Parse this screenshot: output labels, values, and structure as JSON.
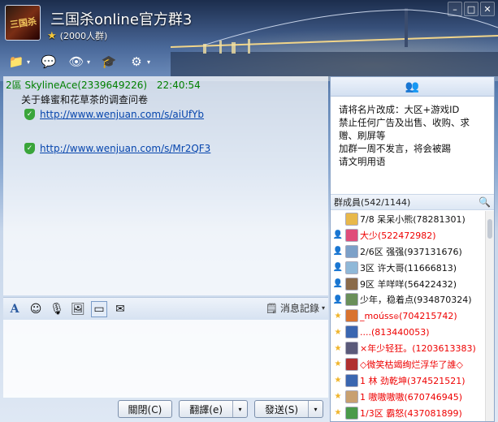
{
  "window": {
    "title": "三国杀online官方群3",
    "member_capacity": "(2000人群)",
    "logo_text": "三国杀",
    "controls": [
      "–",
      "□",
      "✕"
    ]
  },
  "toolbar": {
    "items": [
      {
        "name": "folder-tool",
        "icon": "📁"
      },
      {
        "name": "chat-tool",
        "icon": "💬"
      },
      {
        "name": "video-tool",
        "icon": "👁"
      },
      {
        "name": "app-tool",
        "icon": "🎓"
      },
      {
        "name": "settings-tool",
        "icon": "⚙"
      }
    ]
  },
  "chat": {
    "sender": "2區 SkylineAce(2339649226)",
    "time": "22:40:54",
    "text": "关于蜂蜜和花草茶的调查问卷",
    "links": [
      "http://www.wenjuan.com/s/aiUfYb",
      "http://www.wenjuan.com/s/Mr2QF3"
    ]
  },
  "input_toolbar": {
    "history_label": "消息記錄"
  },
  "buttons": {
    "close": "關閉(C)",
    "translate": "翻譯(e)",
    "send": "發送(S)"
  },
  "notice": {
    "lines": [
      "请将名片改成：大区+游戏ID",
      "禁止任何广告及出售、收购、求",
      "赠、刷屏等",
      "加群一周不发言，将会被踢",
      "请文明用语"
    ]
  },
  "members": {
    "header": "群成員(542/1144)",
    "list": [
      {
        "badge": "",
        "avatar_color": "#e8b84a",
        "name": "7/8 呆呆小熊(78281301)",
        "red": false
      },
      {
        "badge": "👤",
        "avatar_color": "#e04d7a",
        "name": "大少(522472982)",
        "red": true
      },
      {
        "badge": "👤",
        "avatar_color": "#7ca0c8",
        "name": "2/6区 强强(937131676)",
        "red": false
      },
      {
        "badge": "👤",
        "avatar_color": "#8fb8d8",
        "name": "3区 许大哥(11666813)",
        "red": false
      },
      {
        "badge": "👤",
        "avatar_color": "#8a6a4a",
        "name": "9区 羊咩咩(56422432)",
        "red": false
      },
      {
        "badge": "👤",
        "avatar_color": "#6a8f5a",
        "name": "少年，稳着点(934870324)",
        "red": false
      },
      {
        "badge": "★",
        "avatar_color": "#d9732f",
        "name": "_moúss๏(704215742)",
        "red": true
      },
      {
        "badge": "★",
        "avatar_color": "#3a66b0",
        "name": "....(813440053)",
        "red": true
      },
      {
        "badge": "★",
        "avatar_color": "#5a5a7a",
        "name": "×年少轻狂。(1203613383)",
        "red": true
      },
      {
        "badge": "★",
        "avatar_color": "#b03030",
        "name": "◇微笑枯竭绚烂浮华了誰◇",
        "red": true
      },
      {
        "badge": "★",
        "avatar_color": "#3a66b0",
        "name": "1 林 劲乾坤(374521521)",
        "red": true
      },
      {
        "badge": "★",
        "avatar_color": "#c8a070",
        "name": "1 嗷嗷嗷嗷(670746945)",
        "red": true
      },
      {
        "badge": "★",
        "avatar_color": "#4a9a4a",
        "name": "1/3区 霸怒(437081899)",
        "red": true
      }
    ]
  },
  "colors": {
    "link": "#0645ad",
    "sender": "#008000",
    "admin_red": "#e00000"
  }
}
